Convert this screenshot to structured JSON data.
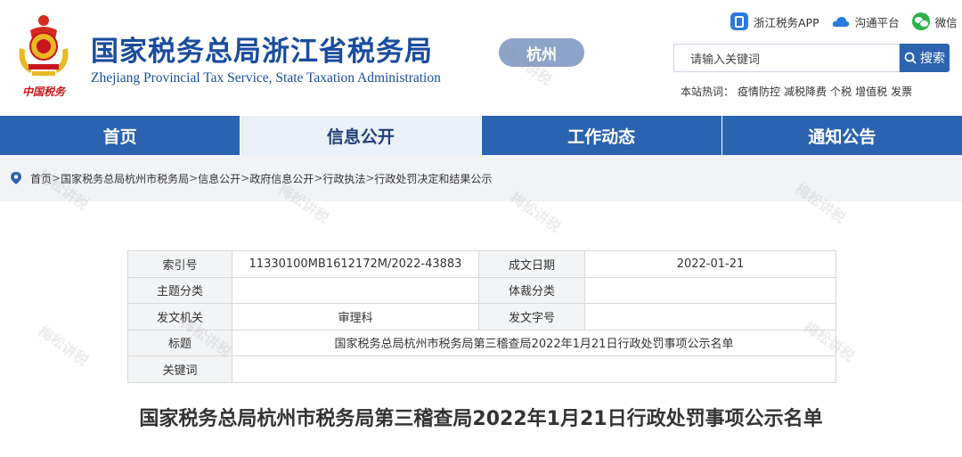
{
  "header": {
    "title_cn": "国家税务总局浙江省税务局",
    "title_en": "Zhejiang Provincial Tax Service, State Taxation Administration",
    "emblem_text": "中国税务",
    "city": "杭州"
  },
  "top_links": [
    {
      "label": "浙江税务APP",
      "icon": "app-icon"
    },
    {
      "label": "沟通平台",
      "icon": "cloud-icon"
    },
    {
      "label": "微信",
      "icon": "wechat-icon"
    }
  ],
  "search": {
    "placeholder": "请输入关键词",
    "button_label": "搜索"
  },
  "hot_words": {
    "label": "本站热词：",
    "items": [
      "疫情防控",
      "减税降费",
      "个税",
      "增值税",
      "发票"
    ]
  },
  "nav": [
    {
      "label": "首页",
      "active": false
    },
    {
      "label": "信息公开",
      "active": true
    },
    {
      "label": "工作动态",
      "active": false
    },
    {
      "label": "通知公告",
      "active": false
    }
  ],
  "breadcrumb": [
    "首页",
    "国家税务总局杭州市税务局",
    "信息公开",
    "政府信息公开",
    "行政执法",
    "行政处罚决定和结果公示"
  ],
  "breadcrumb_sep": ">",
  "info_table": {
    "index_label": "索引号",
    "index_value": "11330100MB1612172M/2022-43883",
    "date_label": "成文日期",
    "date_value": "2022-01-21",
    "topic_label": "主题分类",
    "topic_value": "",
    "genre_label": "体裁分类",
    "genre_value": "",
    "issuer_label": "发文机关",
    "issuer_value": "审理科",
    "docno_label": "发文字号",
    "docno_value": "",
    "title_label": "标题",
    "title_value": "国家税务总局杭州市税务局第三稽查局2022年1月21日行政处罚事项公示名单",
    "keywords_label": "关键词",
    "keywords_value": ""
  },
  "doc_title": "国家税务总局杭州市税务局第三稽查局2022年1月21日行政处罚事项公示名单",
  "watermark": "梅松讲税",
  "colors": {
    "brand_blue": "#1a4c9e",
    "nav_blue": "#2a63b0",
    "nav_active_bg": "#eaf0f8",
    "emblem_red": "#c8161d"
  }
}
